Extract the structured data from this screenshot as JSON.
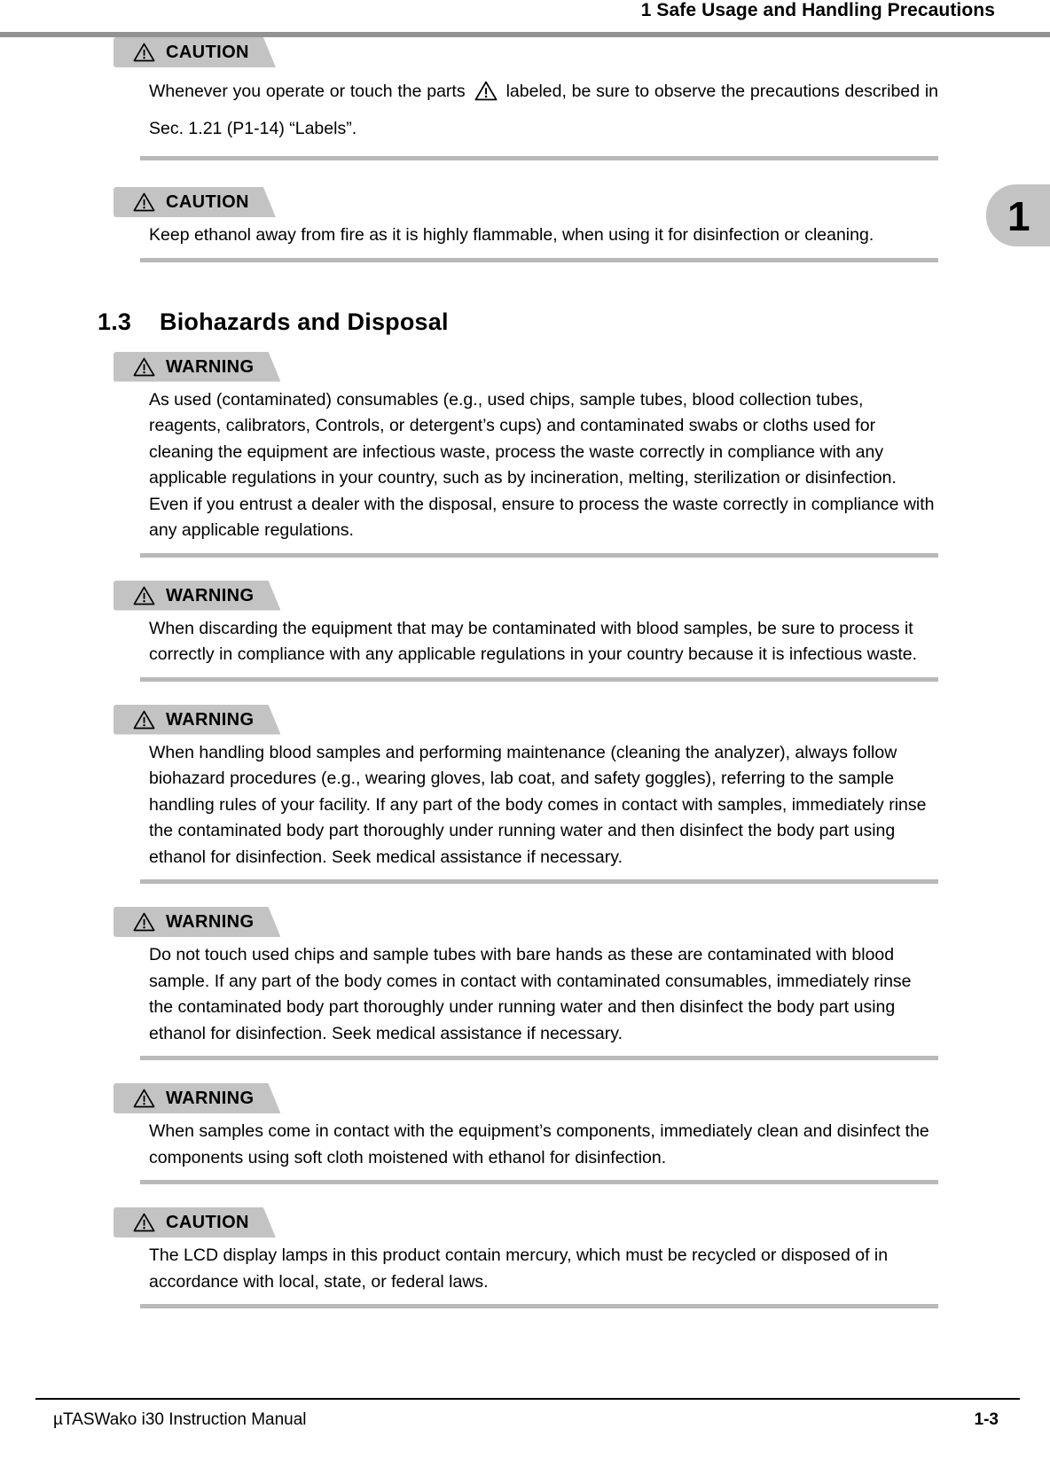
{
  "header": {
    "title": "1 Safe Usage and Handling Precautions"
  },
  "thumb_tab": {
    "number": "1"
  },
  "section": {
    "number": "1.3",
    "title": "Biohazards and Disposal"
  },
  "labels": {
    "caution": "CAUTION",
    "warning": "WARNING"
  },
  "icons": {
    "banner_triangle": "warning-triangle-icon",
    "inline_triangle": "warning-triangle-icon"
  },
  "notices": [
    {
      "label": "CAUTION",
      "text_before": "Whenever you operate or touch the parts",
      "text_after": "labeled, be sure to observe the precautions described in Sec. 1.21 (P1-14) “Labels”.",
      "has_inline_icon": true
    },
    {
      "label": "CAUTION",
      "text": "Keep ethanol away from fire as it is highly flammable, when using it for disinfection or cleaning.",
      "has_inline_icon": false
    },
    {
      "label": "WARNING",
      "text": "As used (contaminated) consumables (e.g., used chips, sample tubes, blood collection tubes, reagents, calibrators, Controls, or detergent’s cups) and contaminated swabs or cloths used for cleaning the equipment are infectious waste, process the waste correctly in compliance with any applicable regulations in your country, such as by incineration, melting, sterilization or disinfection. Even if you entrust a dealer with the disposal, ensure to process the waste correctly in compliance with any applicable regulations.",
      "has_inline_icon": false
    },
    {
      "label": "WARNING",
      "text": "When discarding the equipment that may be contaminated with blood samples, be sure to process it correctly in compliance with any applicable regulations in your country because it is infectious waste.",
      "has_inline_icon": false
    },
    {
      "label": "WARNING",
      "text": "When handling blood samples and performing maintenance (cleaning the analyzer), always follow biohazard procedures (e.g., wearing gloves, lab coat, and safety goggles), referring to the sample handling rules of your facility. If any part of the body comes in contact with samples, immediately rinse the contaminated body part thoroughly under running water and then disinfect the body part using ethanol for disinfection. Seek medical assistance if necessary.",
      "has_inline_icon": false
    },
    {
      "label": "WARNING",
      "text": "Do not touch used chips and sample tubes with bare hands as these are contaminated with blood sample. If any part of the body comes in contact with contaminated consumables, immediately rinse the contaminated body part thoroughly under running water and then disinfect the body part using ethanol for disinfection. Seek medical assistance if necessary.",
      "has_inline_icon": false
    },
    {
      "label": "WARNING",
      "text": "When samples come in contact with the equipment’s components, immediately clean and disinfect the components using soft cloth moistened with ethanol for disinfection.",
      "has_inline_icon": false
    },
    {
      "label": "CAUTION",
      "text": "The LCD display lamps in this product contain mercury, which must be recycled or disposed of in accordance with local, state, or federal laws.",
      "has_inline_icon": false
    }
  ],
  "footer": {
    "left": "µTASWako i30  Instruction Manual",
    "right": "1-3"
  },
  "colors": {
    "banner_fill": "#c3c3c3",
    "rule_gray": "#b9b9b9",
    "header_rule": "#939393",
    "text": "#000000"
  }
}
